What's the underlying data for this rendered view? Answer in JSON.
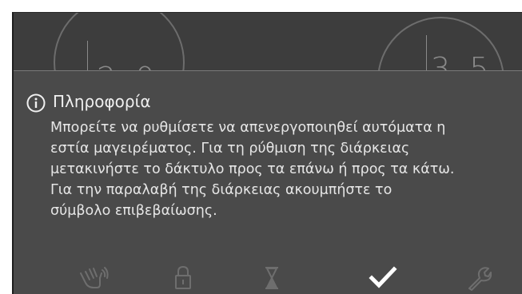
{
  "background_dials": {
    "left_value": "2 0",
    "right_value": "3 5"
  },
  "info_popup": {
    "icon": "info-circle-icon",
    "title": "Πληροφορία",
    "lines": [
      "Μπορείτε να ρυθμίσετε να απενεργοποιηθεί αυτόματα η",
      "εστία μαγειρέματος. Για τη ρύθμιση της διάρκειας",
      "μετακινήστε το δάκτυλο προς τα επάνω ή προς τα κάτω.",
      "Για την παραλαβή της διάρκειας ακουμπήστε το",
      "σύμβολο επιβεβαίωσης."
    ]
  },
  "bottom_bar": {
    "icons": [
      "wipe-protection-icon",
      "lock-icon",
      "hourglass-timer-icon",
      "checkmark-confirm-icon",
      "wrench-settings-icon"
    ],
    "active_icon": "checkmark-confirm-icon"
  },
  "colors": {
    "screen_background": "#3d3d3d",
    "popup_background": "#4a4a4a",
    "text": "#e6e6e6",
    "inactive_icon": "#6e6e6e",
    "active_icon": "#ffffff"
  }
}
